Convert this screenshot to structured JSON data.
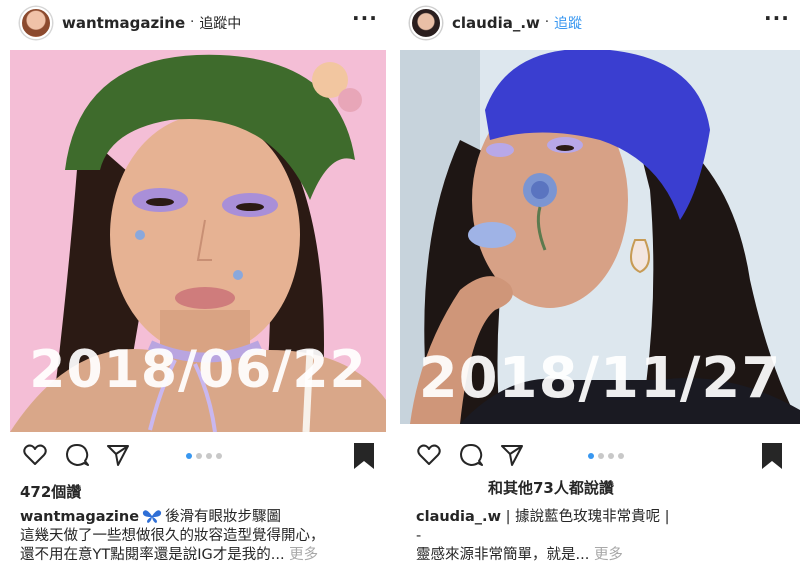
{
  "posts": [
    {
      "username": "wantmagazine",
      "separator": "·",
      "follow_label": "追蹤中",
      "more_label": "···",
      "date_overlay": "2018/06/22",
      "carousel": {
        "count": 4,
        "active": 0
      },
      "likes": "472個讚",
      "caption": {
        "username": "wantmagazine",
        "line1_text": "後滑有眼妝步驟圖",
        "line2": "這幾天做了一些想做很久的妝容造型覺得開心，",
        "line3": "還不用在意YT點閱率還是說IG才是我的",
        "ellipsis": "...",
        "more": "更多"
      },
      "icons": {
        "avatar": "avatar",
        "heart": "heart-icon",
        "comment": "comment-icon",
        "share": "share-icon",
        "save": "bookmark-icon",
        "emoji": "butterfly-icon"
      },
      "colors": {
        "photo_bg": "#f4bed6",
        "hat": "#3e6b2c",
        "choker": "#b9a5e0"
      }
    },
    {
      "username": "claudia_.w",
      "separator": "·",
      "follow_label": "追蹤",
      "more_label": "···",
      "date_overlay": "2018/11/27",
      "carousel": {
        "count": 4,
        "active": 0
      },
      "likes": "和其他73人都說讚",
      "caption": {
        "username": "claudia_.w",
        "line1_text": "| 據說藍色玫瑰非常貴呢 |",
        "line2": "-",
        "line3": "靈感來源非常簡單，就是",
        "ellipsis": "...",
        "more": "更多"
      },
      "icons": {
        "avatar": "avatar",
        "heart": "heart-icon",
        "comment": "comment-icon",
        "share": "share-icon",
        "save": "bookmark-icon"
      },
      "colors": {
        "photo_bg": "#dde7ee",
        "beret": "#3a3ed0",
        "follow": "#3897f0"
      }
    }
  ]
}
